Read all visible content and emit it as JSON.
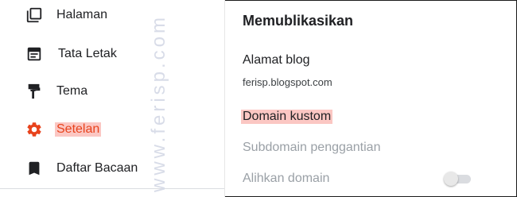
{
  "sidebar": {
    "items": [
      {
        "label": "Halaman",
        "icon": "pages-icon"
      },
      {
        "label": "Tata Letak",
        "icon": "layout-icon"
      },
      {
        "label": "Tema",
        "icon": "theme-roller-icon"
      },
      {
        "label": "Setelan",
        "icon": "gear-icon",
        "active": true
      },
      {
        "label": "Daftar Bacaan",
        "icon": "bookmark-icon"
      }
    ]
  },
  "watermark": "www.ferisp.com",
  "settings": {
    "section_title": "Memublikasikan",
    "blog_address_label": "Alamat blog",
    "blog_address_value": "ferisp.blogspot.com",
    "custom_domain_label": "Domain kustom",
    "fallback_subdomain_label": "Subdomain penggantian",
    "redirect_domain_label": "Alihkan domain",
    "redirect_domain_enabled": false
  },
  "colors": {
    "active": "#e8431c",
    "highlight": "#fbc7c3",
    "text": "#202124",
    "disabled": "#9aa0a6"
  }
}
